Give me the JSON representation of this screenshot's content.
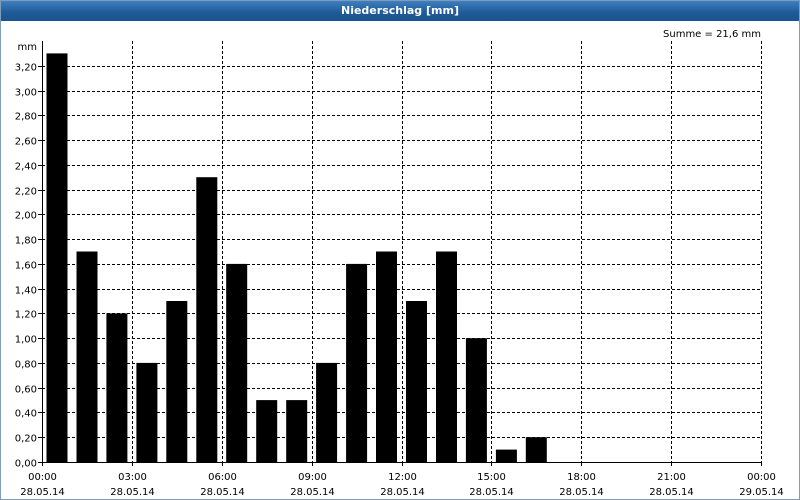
{
  "window": {
    "title": "Niederschlag [mm]"
  },
  "chart_data": {
    "type": "bar",
    "ylabel": "mm",
    "ylim": [
      0,
      3.4
    ],
    "y_ticks": [
      0,
      0.2,
      0.4,
      0.6,
      0.8,
      1.0,
      1.2,
      1.4,
      1.6,
      1.8,
      2.0,
      2.2,
      2.4,
      2.6,
      2.8,
      3.0,
      3.2
    ],
    "y_tick_labels": [
      "0,00",
      "0,20",
      "0,40",
      "0,60",
      "0,80",
      "1,00",
      "1,20",
      "1,40",
      "1,60",
      "1,80",
      "2,00",
      "2,20",
      "2,40",
      "2,60",
      "2,80",
      "3,00",
      "3,20"
    ],
    "x_ticks": [
      {
        "hour": 0,
        "time": "00:00",
        "date": "28.05.14"
      },
      {
        "hour": 3,
        "time": "03:00",
        "date": "28.05.14"
      },
      {
        "hour": 6,
        "time": "06:00",
        "date": "28.05.14"
      },
      {
        "hour": 9,
        "time": "09:00",
        "date": "28.05.14"
      },
      {
        "hour": 12,
        "time": "12:00",
        "date": "28.05.14"
      },
      {
        "hour": 15,
        "time": "15:00",
        "date": "28.05.14"
      },
      {
        "hour": 18,
        "time": "18:00",
        "date": "28.05.14"
      },
      {
        "hour": 21,
        "time": "21:00",
        "date": "28.05.14"
      },
      {
        "hour": 24,
        "time": "00:00",
        "date": "29.05.14"
      }
    ],
    "xlim": [
      0,
      24
    ],
    "hour_starts": [
      0,
      1,
      2,
      3,
      4,
      5,
      6,
      7,
      8,
      9,
      10,
      11,
      12,
      13,
      14,
      15,
      16
    ],
    "values": [
      3.3,
      1.7,
      1.2,
      0.8,
      1.3,
      2.3,
      1.6,
      0.5,
      0.5,
      0.8,
      1.6,
      1.7,
      1.3,
      1.7,
      1.0,
      0.1,
      0.2
    ],
    "annotation": "Summe = 21,6 mm",
    "grid": true,
    "bar_color": "#000000"
  }
}
